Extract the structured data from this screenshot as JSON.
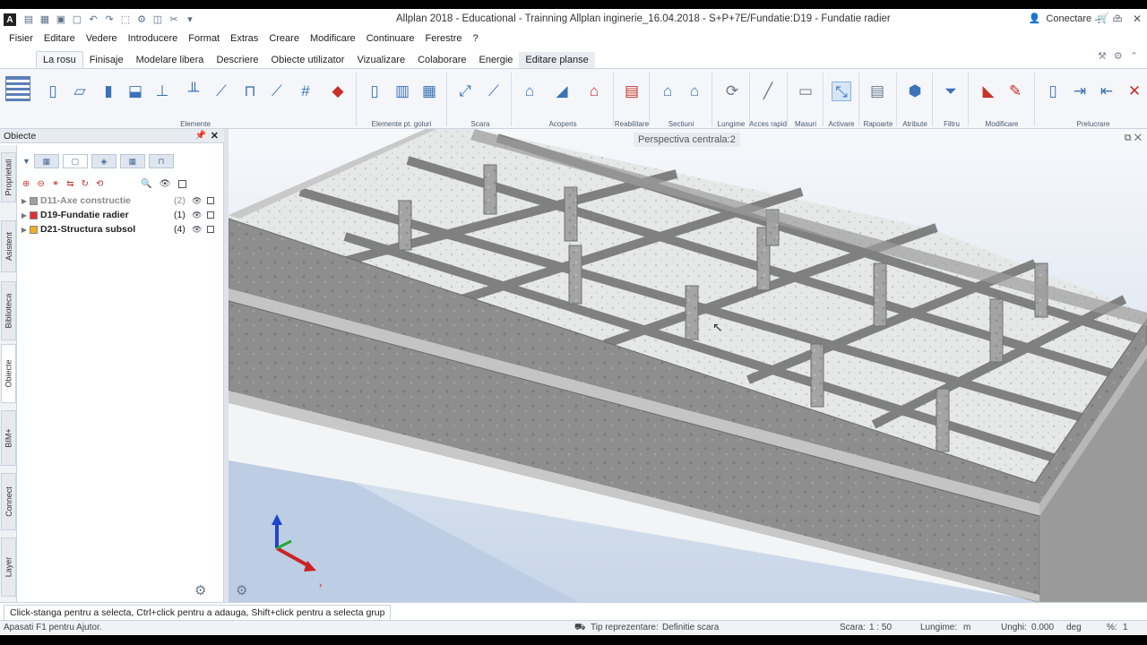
{
  "app": {
    "title": "Allplan 2018 - Educational - Trainning Allplan inginerie_16.04.2018 - S+P+7E/Fundatie:D19 - Fundatie radier",
    "connect_label": "Conectare"
  },
  "menu": [
    "Fisier",
    "Editare",
    "Vedere",
    "Introducere",
    "Format",
    "Extras",
    "Creare",
    "Modificare",
    "Continuare",
    "Ferestre",
    "?"
  ],
  "tabs": [
    "La rosu",
    "Finisaje",
    "Modelare libera",
    "Descriere",
    "Obiecte utilizator",
    "Vizualizare",
    "Colaborare",
    "Energie",
    "Editare planse"
  ],
  "ribbon_groups": [
    "Elemente",
    "Elemente pt. goluri",
    "Scara",
    "Acoperis",
    "Reabilitare",
    "Sectiuni",
    "Lungime",
    "Acces rapid",
    "Masuri",
    "Activare",
    "Rapoarte",
    "Atribute",
    "Filtru",
    "Modificare",
    "Prelucrare"
  ],
  "panel": {
    "title": "Obiecte",
    "items": [
      {
        "name": "D11-Axe constructie",
        "count": "(2)",
        "color": "#a0a0a0",
        "muted": true
      },
      {
        "name": "D19-Fundatie radier",
        "count": "(1)",
        "color": "#e03030",
        "muted": false
      },
      {
        "name": "D21-Structura subsol",
        "count": "(4)",
        "color": "#f0b020",
        "muted": false
      }
    ]
  },
  "side_tabs": [
    "Proprietati",
    "Asistent",
    "Biblioteca",
    "Obiecte",
    "BIM+",
    "Connect",
    "Layer"
  ],
  "viewport": {
    "label": "Perspectiva centrala:2"
  },
  "status": {
    "hint": "Click-stanga pentru a selecta, Ctrl+click pentru a adauga, Shift+click pentru a selecta grup",
    "help": "Apasati F1 pentru Ajutor.",
    "repr_label": "Tip reprezentare:",
    "repr_value": "Definitie scara",
    "scale_label": "Scara:",
    "scale_value": "1 : 50",
    "length_label": "Lungime:",
    "length_value": "m",
    "angle_label": "Unghi:",
    "angle_value": "0.000",
    "angle_unit": "deg",
    "percent": "%:",
    "percent_value": "1"
  },
  "colors": {
    "accent": "#3b72b8",
    "danger": "#c8322b",
    "ribbon_bg": "#f4f6f9"
  }
}
